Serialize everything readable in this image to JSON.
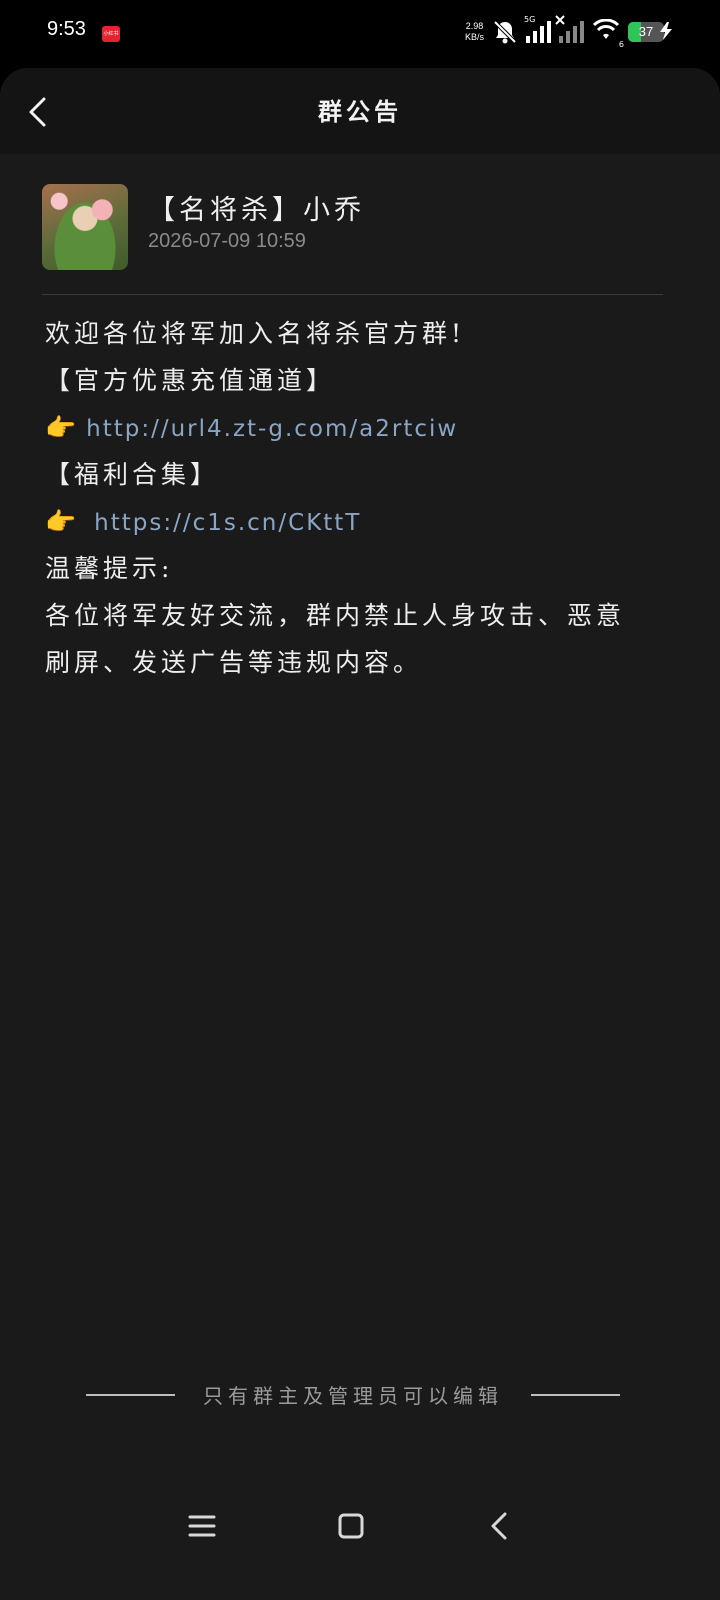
{
  "status_bar": {
    "time": "9:53",
    "notif_app_label": "小红书",
    "net_speed_value": "2.98",
    "net_speed_unit": "KB/s",
    "sim_tag": "5G",
    "wifi_tag": "6",
    "battery_level": "37",
    "battery_fraction": 0.37,
    "icons": [
      "notification-app-icon",
      "mute-bell-icon",
      "signal-icon",
      "no-signal-icon",
      "wifi-icon",
      "battery-icon",
      "charging-icon"
    ],
    "colors": {
      "app_badge": "#e8222e",
      "battery": "#2ec55a"
    }
  },
  "header": {
    "title": "群公告",
    "back_icon": "chevron-left-icon"
  },
  "announcement": {
    "author": "【名将杀】小乔",
    "time": "2026-07-09 10:59",
    "lines": [
      {
        "text": "欢迎各位将军加入名将杀官方群!"
      },
      {
        "text": "【官方优惠充值通道】"
      },
      {
        "emoji": "👉",
        "link": "http://url4.zt-g.com/a2rtciw"
      },
      {
        "text": "【福利合集】"
      },
      {
        "emoji": "👉",
        "link": "https://c1s.cn/CKttT"
      },
      {
        "text": "温馨提示:"
      },
      {
        "text": "各位将军友好交流，群内禁止人身攻击、恶意"
      },
      {
        "text": "刷屏、发送广告等违规内容。"
      }
    ]
  },
  "footer": {
    "note": "只有群主及管理员可以编辑"
  },
  "nav_bar": {
    "icons": [
      "menu-icon",
      "home-icon",
      "back-icon"
    ]
  },
  "theme": {
    "background": "#1a1a1b",
    "link_color": "#8aa6c4"
  }
}
